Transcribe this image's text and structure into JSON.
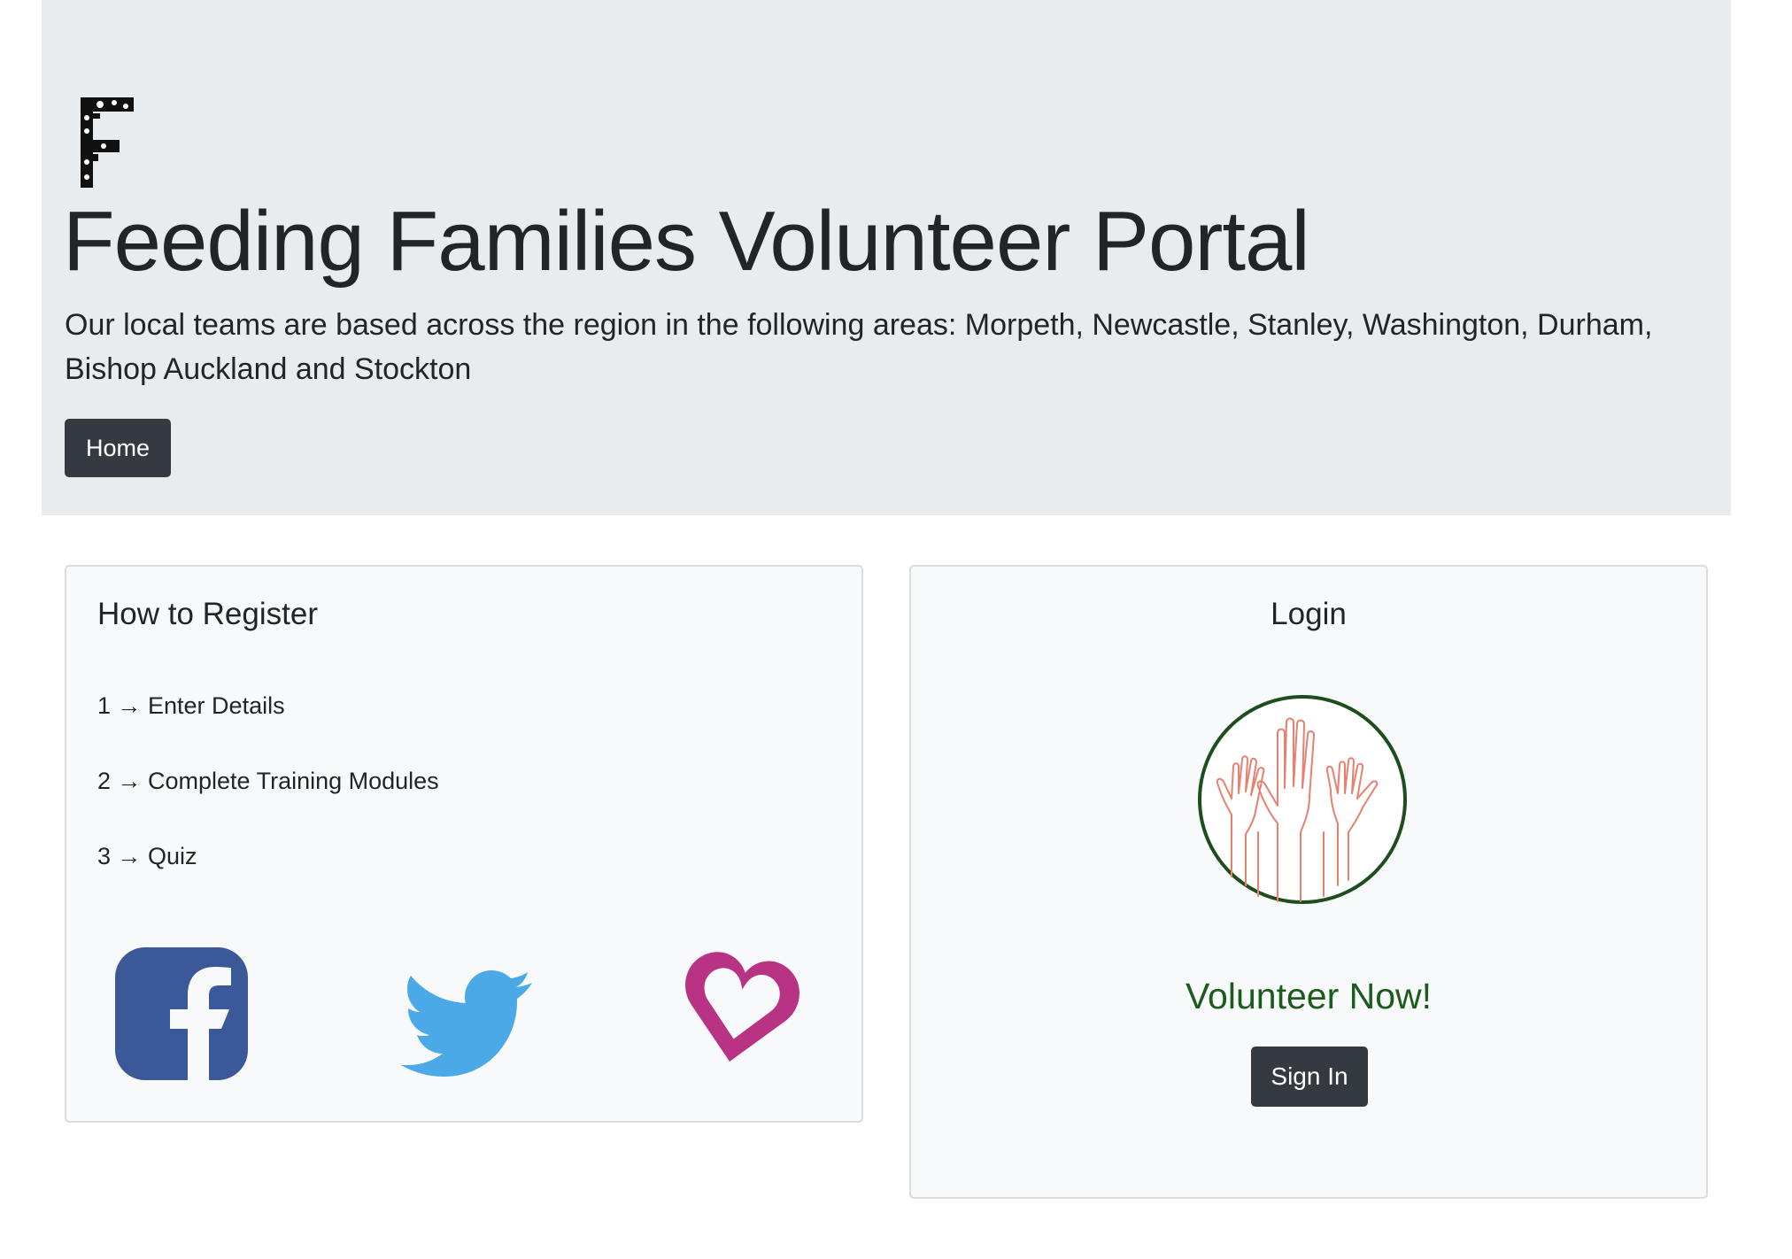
{
  "header": {
    "logo_icon": "letter-f-logo-icon",
    "title": "Feeding Families Volunteer Portal",
    "lead": "Our local teams are based across the region in the following areas: Morpeth, Newcastle, Stanley, Washington, Durham, Bishop Auckland and Stockton",
    "home_label": "Home"
  },
  "register": {
    "title": "How to Register",
    "steps": [
      "1 → Enter Details",
      "2 → Complete Training Modules",
      "3 → Quiz"
    ],
    "social": [
      {
        "icon": "facebook-icon",
        "color": "#3b5998"
      },
      {
        "icon": "twitter-icon",
        "color": "#4aa9e6"
      },
      {
        "icon": "heart-icon",
        "color": "#b93385"
      }
    ]
  },
  "login": {
    "title": "Login",
    "image_icon": "raised-hands-icon",
    "cta": "Volunteer Now!",
    "signin_label": "Sign In"
  },
  "colors": {
    "jumbotron_bg": "#e9ecef",
    "button_dark": "#343a40",
    "cta_green": "#1b5b1b",
    "hands_circle": "#1e4d1e",
    "hands_lines": "#e8806f"
  }
}
